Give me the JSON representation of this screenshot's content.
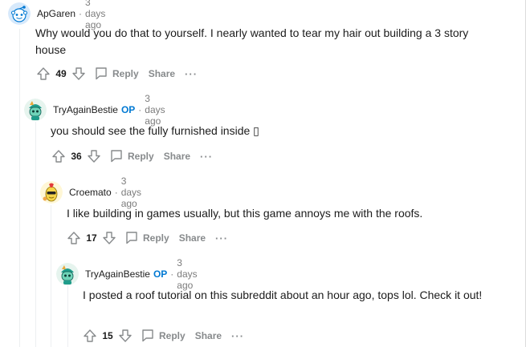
{
  "labels": {
    "reply": "Reply",
    "share": "Share",
    "more": "···",
    "op": "OP",
    "dot": "·"
  },
  "colors": {
    "op": "#0079d3",
    "meta": "#7c7c7c",
    "action": "#878a8c",
    "thread": "#edeff1"
  },
  "comments": [
    {
      "author": "ApGaren",
      "time": "3 days ago",
      "body": "Why would you do that to yourself. I nearly wanted to tear my hair out building a 3 story house",
      "score": "49",
      "avatar_icon": "snoo-avatar-icon"
    },
    {
      "author": "TryAgainBestie",
      "is_op": true,
      "time": "3 days ago",
      "body": "you should see the fully furnished inside ▯",
      "score": "36",
      "avatar_icon": "green-character-avatar-icon"
    },
    {
      "author": "Croemato",
      "time": "3 days ago",
      "body": "I like building in games usually, but this game annoys me with the roofs.",
      "score": "17",
      "avatar_icon": "yellow-character-avatar-icon"
    },
    {
      "author": "TryAgainBestie",
      "is_op": true,
      "time": "3 days ago",
      "body": "I posted a roof tutorial on this subreddit about an hour ago, tops lol. Check it out!",
      "score": "15",
      "avatar_icon": "green-character-avatar-icon"
    }
  ]
}
